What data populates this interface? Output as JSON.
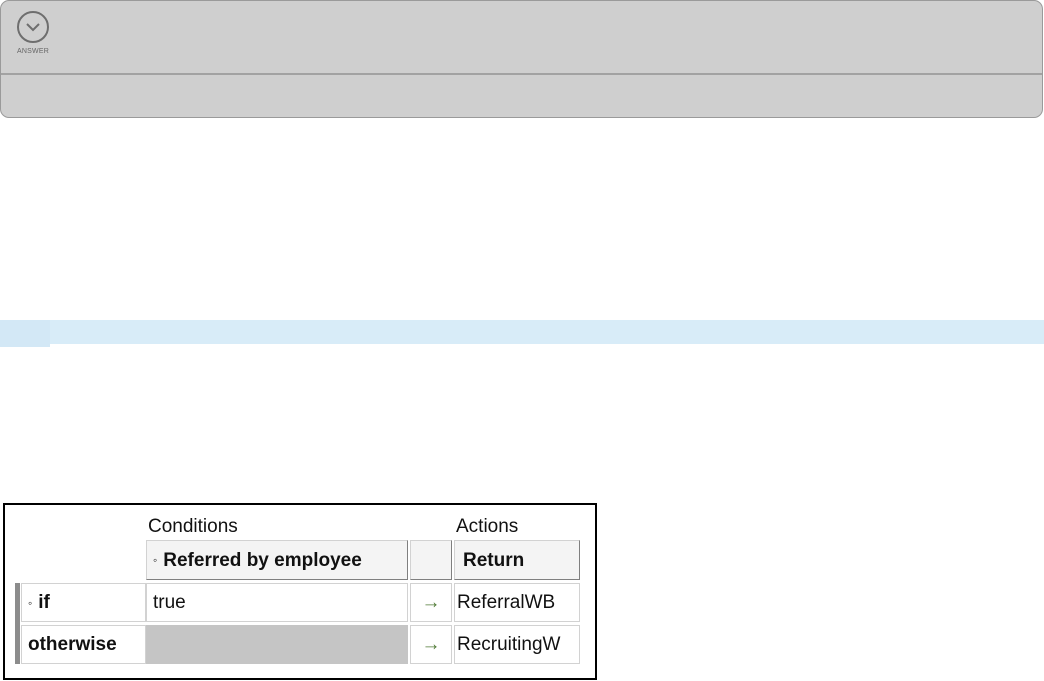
{
  "answer_panel": {
    "label": "ANSWER",
    "icon": "chevron-down-icon"
  },
  "decision_table": {
    "conditions_title": "Conditions",
    "actions_title": "Actions",
    "condition_header_bullet": "◦",
    "condition_header": "Referred by employee",
    "action_header": "Return",
    "rows": [
      {
        "bullet": "◦",
        "label": "if",
        "value": "true",
        "arrow": "→",
        "result": "ReferralWB"
      },
      {
        "bullet": "",
        "label": "otherwise",
        "value": "",
        "arrow": "→",
        "result": "RecruitingW"
      }
    ],
    "colors": {
      "arrow": "#4f7a35",
      "otherwise_cell": "#c5c5c5"
    }
  }
}
